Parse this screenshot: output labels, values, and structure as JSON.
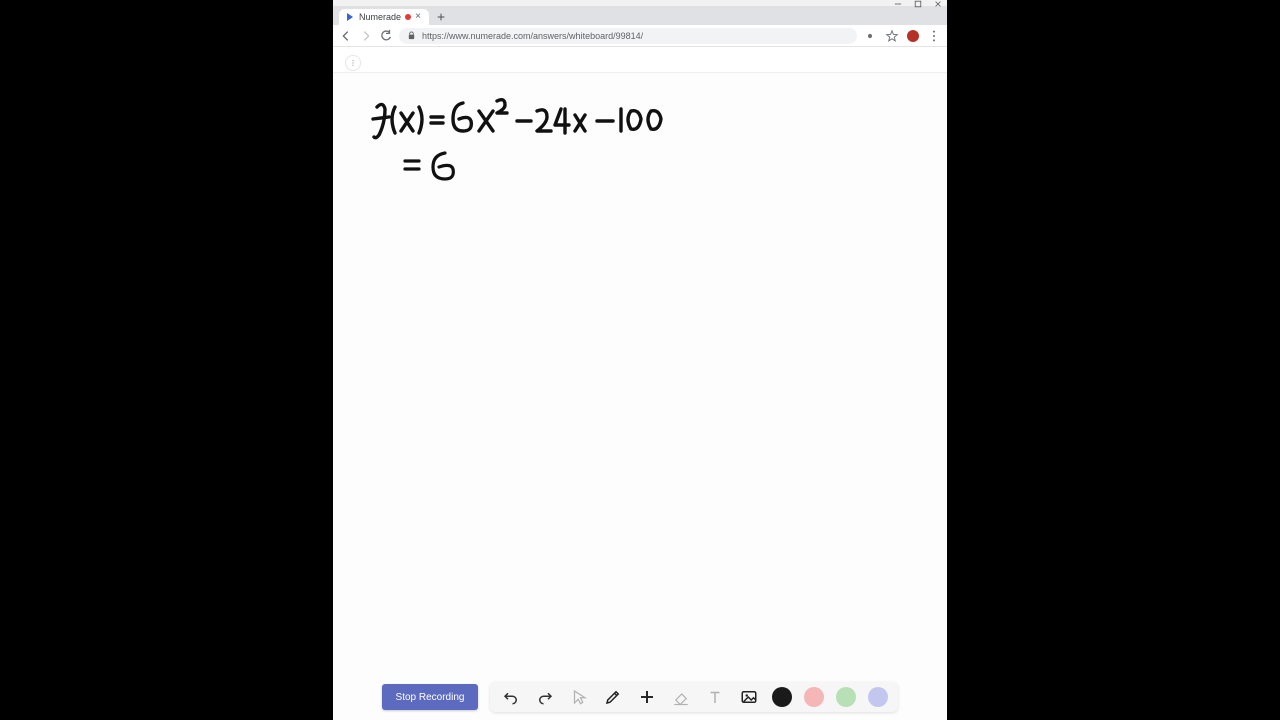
{
  "window": {
    "controls": {
      "min": "–",
      "max": "□",
      "close": "✕"
    }
  },
  "browser": {
    "tab": {
      "title": "Numerade",
      "recording": true
    },
    "newtab_label": "+",
    "nav": {
      "back": "←",
      "forward": "→",
      "reload": "⟳"
    },
    "address": {
      "url": "https://www.numerade.com/answers/whiteboard/99814/"
    },
    "right_icons": {
      "eye": "●",
      "star": "☆"
    }
  },
  "app": {
    "top_icon_glyph": "⋮"
  },
  "handwriting": {
    "line1": "f(x) = 6x² − 24x − 100",
    "line2": "= 6"
  },
  "toolbar": {
    "stop_label": "Stop Recording",
    "tools": {
      "undo": "undo",
      "redo": "redo",
      "cursor": "cursor",
      "pen": "pen",
      "add": "add",
      "eraser": "eraser",
      "text": "text",
      "image": "image"
    },
    "colors": {
      "black": "#1a1a1a",
      "pink": "#f4b6b6",
      "green": "#b7e0b7",
      "purple": "#c3c7ef"
    }
  }
}
